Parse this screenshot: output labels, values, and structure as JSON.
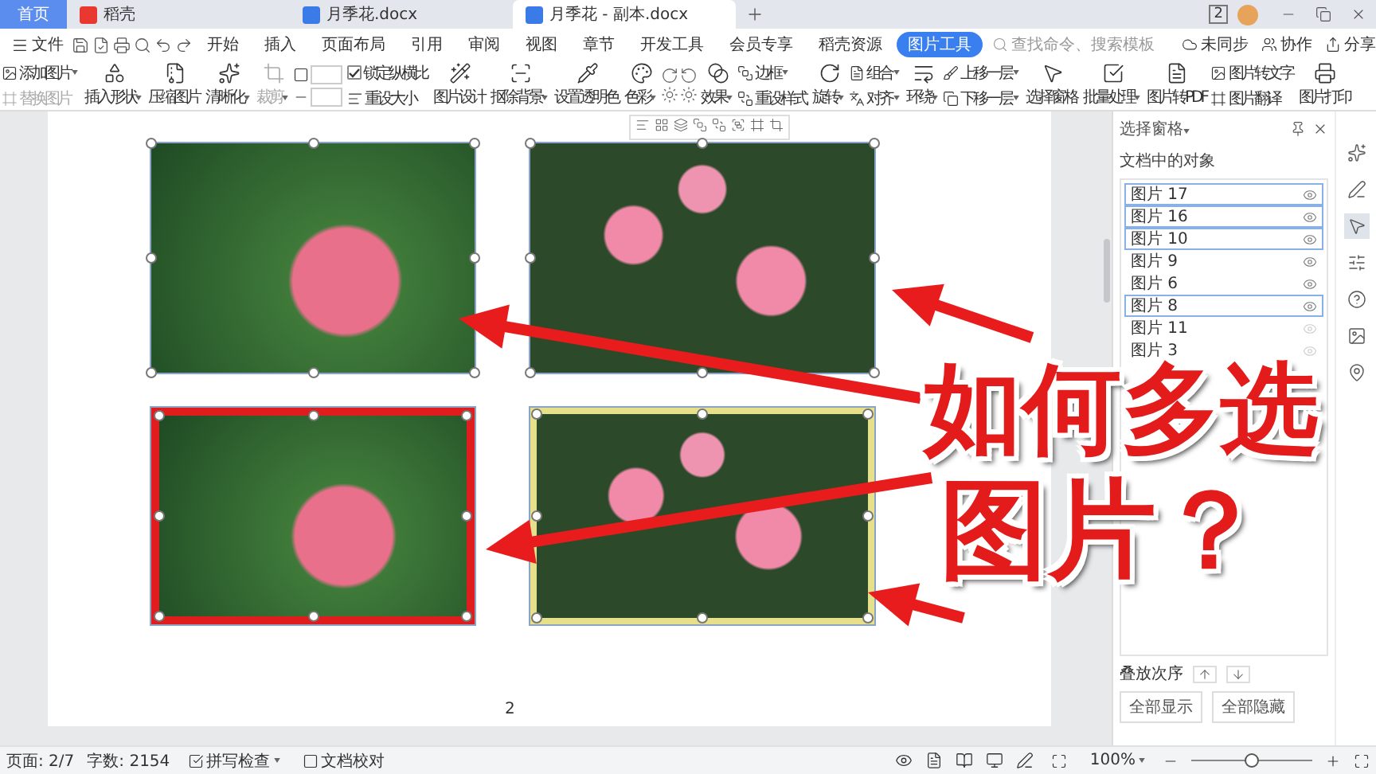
{
  "tabs": [
    {
      "label": "首页",
      "kind": "home",
      "selected": false
    },
    {
      "label": "稻壳",
      "kind": "app",
      "selected": false
    },
    {
      "label": "月季花.docx",
      "kind": "doc",
      "selected": false
    },
    {
      "label": "月季花 - 副本.docx",
      "kind": "doc",
      "selected": true
    }
  ],
  "window_count": "2",
  "menu": {
    "file": "文件",
    "items": [
      {
        "label": "开始",
        "selected": false
      },
      {
        "label": "插入",
        "selected": false
      },
      {
        "label": "页面布局",
        "selected": false
      },
      {
        "label": "引用",
        "selected": false
      },
      {
        "label": "审阅",
        "selected": false
      },
      {
        "label": "视图",
        "selected": false
      },
      {
        "label": "章节",
        "selected": false
      },
      {
        "label": "开发工具",
        "selected": false
      },
      {
        "label": "会员专享",
        "selected": false
      },
      {
        "label": "稻壳资源",
        "selected": false
      },
      {
        "label": "图片工具",
        "selected": true
      }
    ],
    "search": {
      "placeholder": "查找命令、搜索模板"
    },
    "actions": [
      "未同步",
      "协作",
      "分享"
    ]
  },
  "ribbon": [
    {
      "kind": "stack",
      "items": [
        {
          "label": "添加图片",
          "dropdown": true,
          "disabled": false
        },
        {
          "label": "替换图片",
          "dropdown": false,
          "disabled": true
        }
      ]
    },
    {
      "kind": "big",
      "label": "插入形状",
      "dropdown": true,
      "disabled": false
    },
    {
      "kind": "big",
      "label": "压缩图片",
      "dropdown": false,
      "disabled": false
    },
    {
      "kind": "big",
      "label": "清晰化",
      "dropdown": true,
      "disabled": false
    },
    {
      "kind": "big",
      "label": "裁剪",
      "dropdown": true,
      "disabled": true
    },
    {
      "kind": "size"
    },
    {
      "kind": "stack",
      "items": [
        {
          "label": "锁定纵横比",
          "dropdown": false,
          "disabled": false,
          "checked": true
        },
        {
          "label": "重设大小",
          "dropdown": false,
          "disabled": false
        }
      ]
    },
    {
      "kind": "big",
      "label": "图片设计",
      "dropdown": false,
      "disabled": false
    },
    {
      "kind": "big",
      "label": "抠除背景",
      "dropdown": true,
      "disabled": false
    },
    {
      "kind": "big",
      "label": "设置透明色",
      "dropdown": false,
      "disabled": false
    },
    {
      "kind": "big",
      "label": "色彩",
      "dropdown": true,
      "disabled": false
    },
    {
      "kind": "icons"
    },
    {
      "kind": "big",
      "label": "效果",
      "dropdown": true,
      "disabled": false
    },
    {
      "kind": "stack",
      "items": [
        {
          "label": "边框",
          "dropdown": true,
          "disabled": false
        },
        {
          "label": "重设样式",
          "dropdown": false,
          "disabled": false
        }
      ]
    },
    {
      "kind": "big",
      "label": "旋转",
      "dropdown": true,
      "disabled": false
    },
    {
      "kind": "stack",
      "items": [
        {
          "label": "组合",
          "dropdown": true,
          "disabled": false
        },
        {
          "label": "对齐",
          "dropdown": true,
          "disabled": false
        }
      ]
    },
    {
      "kind": "big",
      "label": "环绕",
      "dropdown": true,
      "disabled": false
    },
    {
      "kind": "stack",
      "items": [
        {
          "label": "上移一层",
          "dropdown": true,
          "disabled": false
        },
        {
          "label": "下移一层",
          "dropdown": true,
          "disabled": false
        }
      ]
    },
    {
      "kind": "big",
      "label": "选择窗格",
      "dropdown": false,
      "disabled": false
    },
    {
      "kind": "big",
      "label": "批量处理",
      "dropdown": true,
      "disabled": false
    },
    {
      "kind": "big",
      "label": "图片转PDF",
      "dropdown": false,
      "disabled": false
    },
    {
      "kind": "stack",
      "items": [
        {
          "label": "图片转文字",
          "dropdown": false,
          "disabled": false
        },
        {
          "label": "图片翻译",
          "dropdown": false,
          "disabled": false
        }
      ]
    },
    {
      "kind": "big",
      "label": "图片打印",
      "dropdown": false,
      "disabled": false
    }
  ],
  "document": {
    "images": [
      {
        "kind": "plain",
        "selected": true
      },
      {
        "kind": "plain",
        "selected": true
      },
      {
        "kind": "festive",
        "selected": true
      },
      {
        "kind": "bordered",
        "selected": true
      }
    ],
    "page_number": "2"
  },
  "overlay": {
    "lines": [
      "如何多选",
      "图片？"
    ]
  },
  "selection_pane": {
    "title": "选择窗格",
    "heading": "文档中的对象",
    "items": [
      {
        "label": "图片 17",
        "selected": true,
        "visible": true
      },
      {
        "label": "图片 16",
        "selected": true,
        "visible": true
      },
      {
        "label": "图片 10",
        "selected": true,
        "visible": true
      },
      {
        "label": "图片 9",
        "selected": false,
        "visible": true
      },
      {
        "label": "图片 6",
        "selected": false,
        "visible": true
      },
      {
        "label": "图片 8",
        "selected": true,
        "visible": true
      },
      {
        "label": "图片 11",
        "selected": false,
        "visible": false
      },
      {
        "label": "图片 3",
        "selected": false,
        "visible": false
      }
    ],
    "order_label": "叠放次序",
    "buttons": [
      "全部显示",
      "全部隐藏"
    ]
  },
  "status_bar": {
    "page": "页面: 2/7",
    "words": "字数: 2154",
    "spell": "拼写检查",
    "proof": "文档校对",
    "zoom": "100%",
    "zoom_slider": {
      "level": 0.5
    }
  }
}
